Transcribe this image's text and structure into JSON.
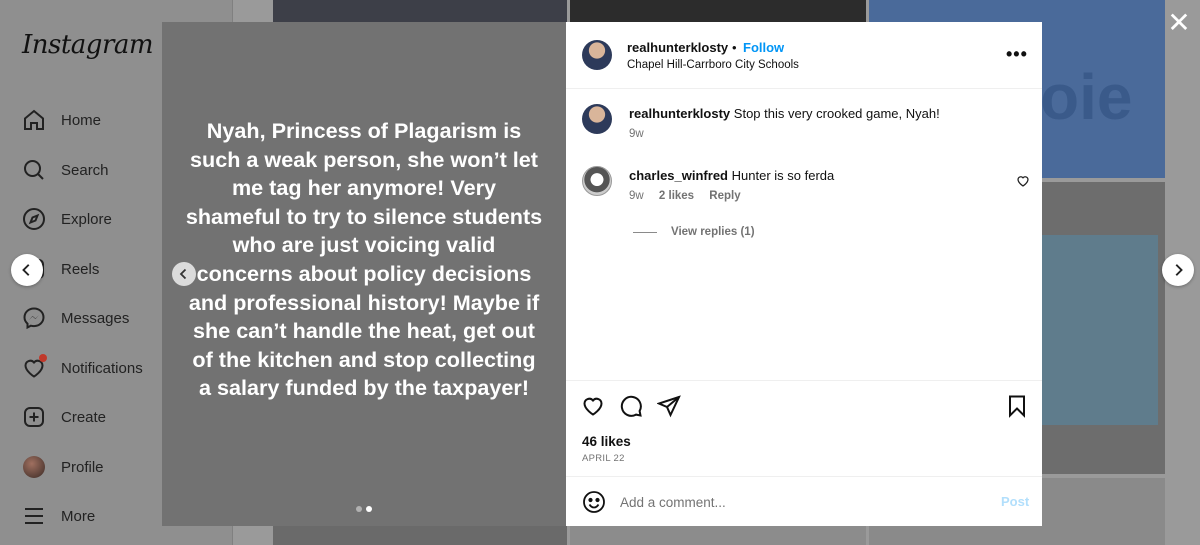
{
  "sidebar": {
    "logo": "Instagram",
    "items": [
      {
        "label": "Home",
        "icon": "home-icon"
      },
      {
        "label": "Search",
        "icon": "search-icon"
      },
      {
        "label": "Explore",
        "icon": "explore-icon"
      },
      {
        "label": "Reels",
        "icon": "reels-icon"
      },
      {
        "label": "Messages",
        "icon": "messages-icon"
      },
      {
        "label": "Notifications",
        "icon": "heart-icon"
      },
      {
        "label": "Create",
        "icon": "create-icon"
      },
      {
        "label": "Profile",
        "icon": "avatar"
      },
      {
        "label": "More",
        "icon": "menu-icon"
      }
    ]
  },
  "background": {
    "tile_text": "oie"
  },
  "modal": {
    "media": {
      "text": "Nyah, Princess of Plagarism is such a weak person, she won’t let me tag her anymore! Very shameful to try to silence students who are just voicing valid concerns about policy decisions and professional history! Maybe if she can’t handle the heat, get out of the kitchen and stop collecting a salary funded by the taxpayer!",
      "slide_count": 2,
      "active_slide": 2
    },
    "header": {
      "username": "realhunterklosty",
      "separator": "•",
      "follow_label": "Follow",
      "location": "Chapel Hill-Carrboro City Schools"
    },
    "comments": [
      {
        "username": "realhunterklosty",
        "text": "Stop this very crooked game, Nyah!",
        "time": "9w"
      },
      {
        "username": "charles_winfred",
        "text": "Hunter is so ferda",
        "time": "9w",
        "likes": "2 likes",
        "reply_label": "Reply",
        "view_replies": "View replies (1)"
      }
    ],
    "likes": "46 likes",
    "date": "APRIL 22",
    "add_comment": {
      "placeholder": "Add a comment...",
      "post_label": "Post"
    }
  },
  "colors": {
    "follow": "#0095f6",
    "post_disabled": "#b2dffc",
    "media_bg": "#727272"
  }
}
